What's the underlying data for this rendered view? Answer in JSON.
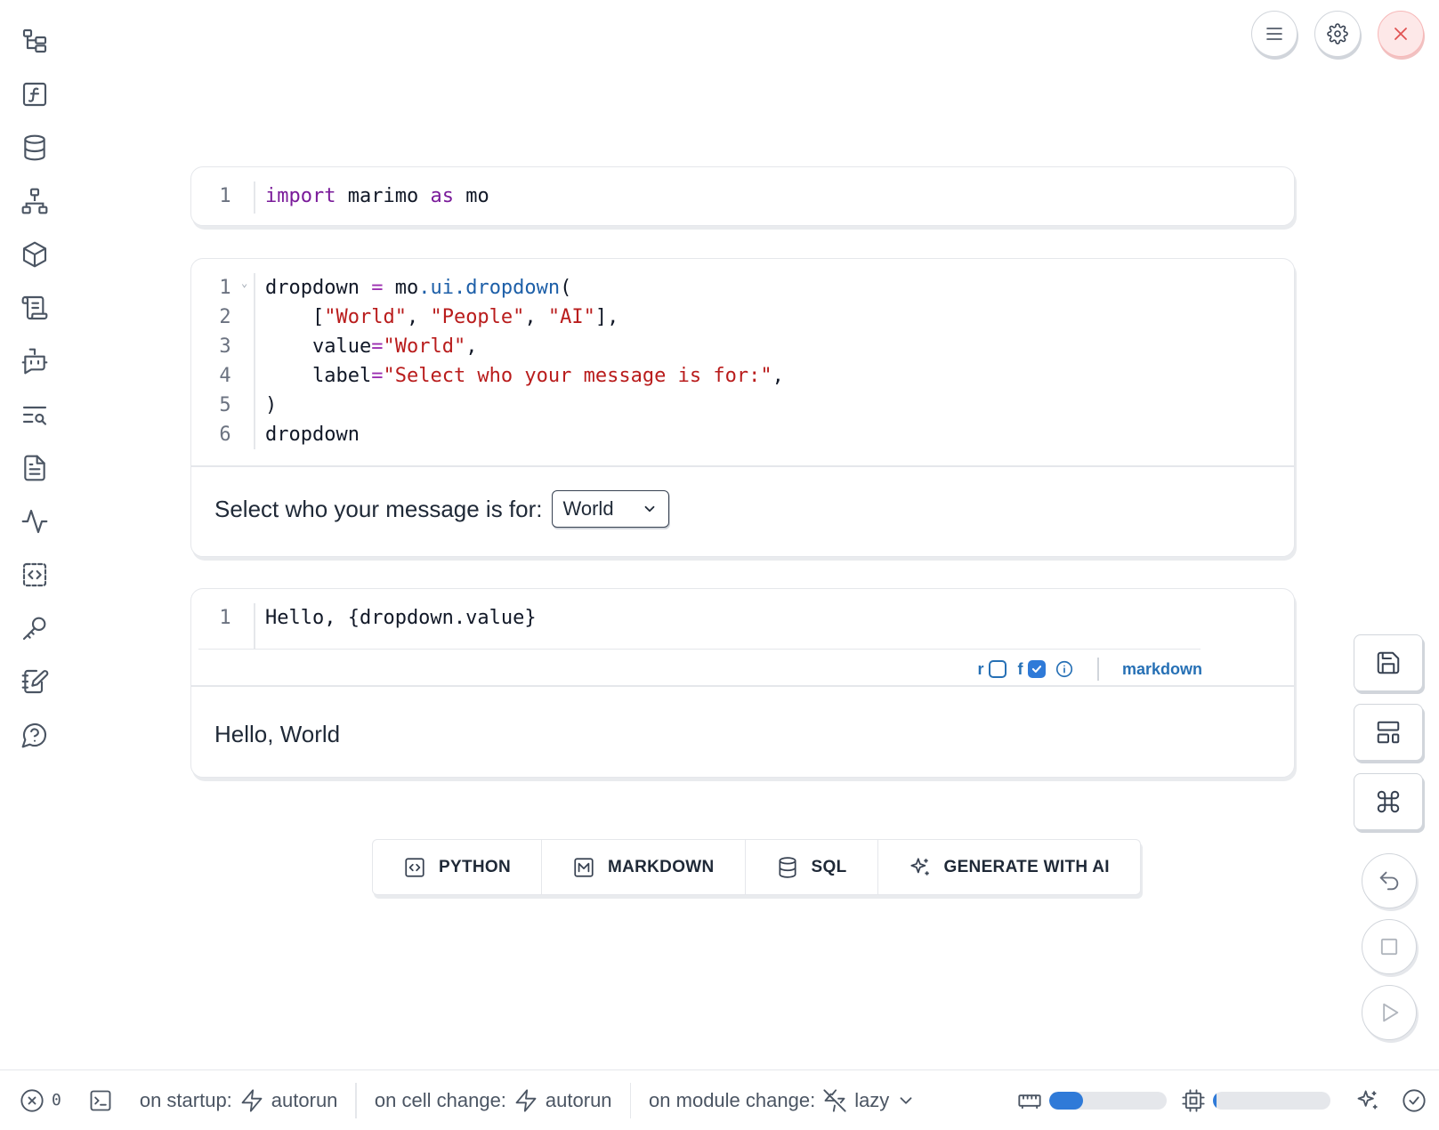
{
  "cells": [
    {
      "lines": [
        {
          "n": "1",
          "tokens": [
            {
              "t": "import",
              "c": "kw"
            },
            {
              "t": " marimo ",
              "c": ""
            },
            {
              "t": "as",
              "c": "kw"
            },
            {
              "t": " mo",
              "c": ""
            }
          ]
        }
      ]
    },
    {
      "lines": [
        {
          "n": "1",
          "tokens": [
            {
              "t": "dropdown ",
              "c": ""
            },
            {
              "t": "=",
              "c": "op"
            },
            {
              "t": " mo",
              "c": ""
            },
            {
              "t": ".ui.dropdown",
              "c": "attr"
            },
            {
              "t": "(",
              "c": ""
            }
          ]
        },
        {
          "n": "2",
          "tokens": [
            {
              "t": "    [",
              "c": ""
            },
            {
              "t": "\"World\"",
              "c": "str"
            },
            {
              "t": ", ",
              "c": ""
            },
            {
              "t": "\"People\"",
              "c": "str"
            },
            {
              "t": ", ",
              "c": ""
            },
            {
              "t": "\"AI\"",
              "c": "str"
            },
            {
              "t": "],",
              "c": ""
            }
          ]
        },
        {
          "n": "3",
          "tokens": [
            {
              "t": "    value",
              "c": ""
            },
            {
              "t": "=",
              "c": "op"
            },
            {
              "t": "\"World\"",
              "c": "str"
            },
            {
              "t": ",",
              "c": ""
            }
          ]
        },
        {
          "n": "4",
          "tokens": [
            {
              "t": "    label",
              "c": ""
            },
            {
              "t": "=",
              "c": "op"
            },
            {
              "t": "\"Select who your message is for:\"",
              "c": "str"
            },
            {
              "t": ",",
              "c": ""
            }
          ]
        },
        {
          "n": "5",
          "tokens": [
            {
              "t": ")",
              "c": ""
            }
          ]
        },
        {
          "n": "6",
          "tokens": [
            {
              "t": "dropdown",
              "c": ""
            }
          ]
        }
      ],
      "output": {
        "label": "Select who your message is for:",
        "selected": "World"
      }
    },
    {
      "lines": [
        {
          "n": "1",
          "tokens": [
            {
              "t": "Hello, {dropdown.value}",
              "c": ""
            }
          ]
        }
      ],
      "tools": {
        "r_label": "r",
        "f_label": "f",
        "lang": "markdown"
      },
      "output": {
        "text": "Hello, World"
      }
    }
  ],
  "add_buttons": {
    "python": "PYTHON",
    "markdown": "MARKDOWN",
    "sql": "SQL",
    "ai": "GENERATE WITH AI"
  },
  "footer": {
    "errors": "0",
    "startup_label": "on startup:",
    "startup_value": "autorun",
    "cell_change_label": "on cell change:",
    "cell_change_value": "autorun",
    "module_change_label": "on module change:",
    "module_change_value": "lazy",
    "memory_fraction": 0.29,
    "cpu_fraction": 0.03
  },
  "colors": {
    "accent": "#2f7ad8",
    "keyword": "#7a1b9a",
    "string": "#b91c1c",
    "attribute": "#1d5fa8",
    "close": "#e05252"
  }
}
